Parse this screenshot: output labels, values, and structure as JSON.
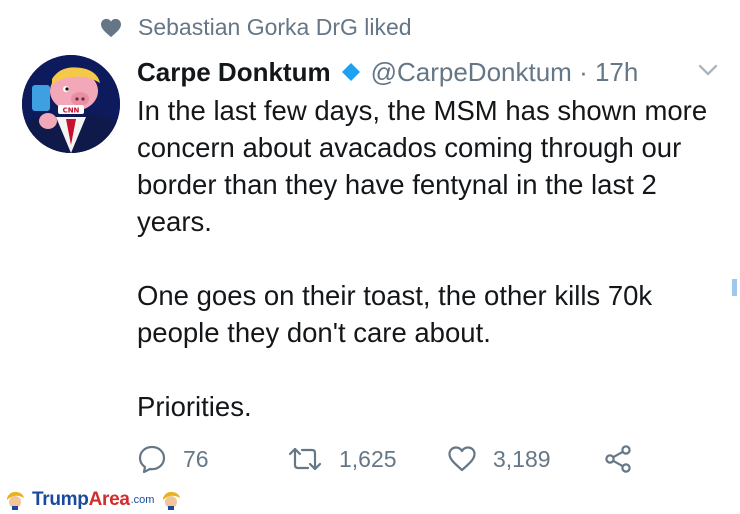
{
  "social_context": {
    "text": "Sebastian Gorka DrG liked",
    "icon": "heart-icon"
  },
  "tweet": {
    "display_name": "Carpe Donktum",
    "verified": true,
    "handle": "@CarpeDonktum",
    "separator": "·",
    "time": "17h",
    "paragraphs": [
      "In the last few days, the MSM has shown more concern about avacados coming through our border than they have fentynal in the last 2 years.",
      "One goes on their toast, the other kills 70k people they don't care about.",
      "Priorities."
    ]
  },
  "actions": {
    "reply_count": "76",
    "retweet_count": "1,625",
    "like_count": "3,189"
  },
  "watermark": {
    "brand_part1": "Trump",
    "brand_part2": "Area",
    "suffix": ".com"
  },
  "colors": {
    "text": "#14171a",
    "muted": "#657786",
    "verified_blue": "#1da1f2",
    "watermark_blue": "#1a4a9e",
    "watermark_red": "#d22d2d"
  }
}
